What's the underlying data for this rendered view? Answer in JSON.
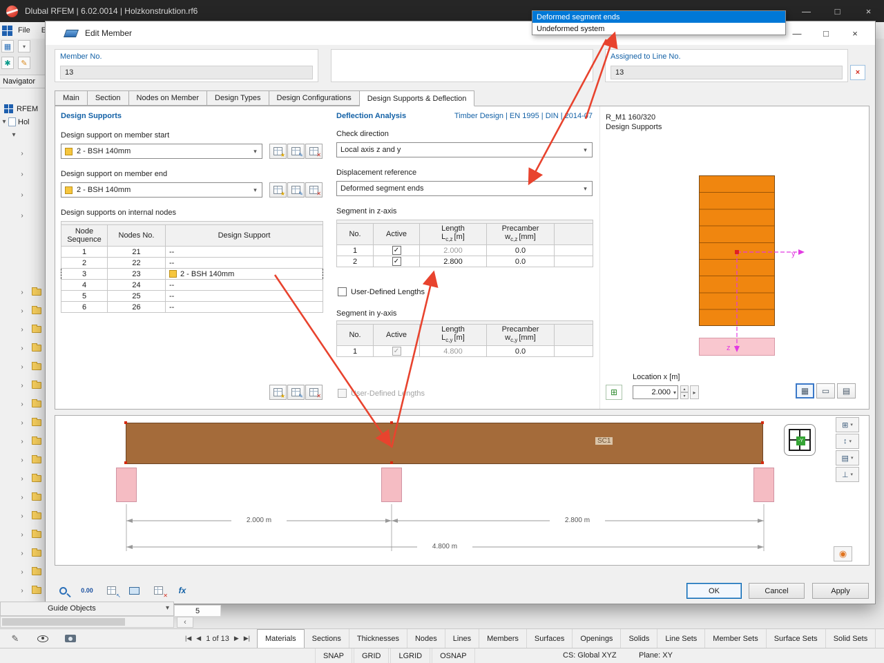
{
  "app": {
    "title": "Dlubal RFEM | 6.02.0014 | Holzkonstruktion.rf6",
    "menu_file": "File",
    "menu_edit_partial": "E"
  },
  "icons": {
    "minimize": "—",
    "maximize": "□",
    "close": "×",
    "chevron_down": "▾",
    "chevron_right": "›",
    "check": "✓",
    "nav_first": "|◀",
    "nav_prev": "◀",
    "nav_next": "▶",
    "nav_last": "▶|",
    "scroll_left": "‹",
    "spin_up": "▴",
    "spin_down": "▾",
    "arrow_right": "▸",
    "layers": "⊞",
    "updown": "↕",
    "list": "▤",
    "axes": "⊥",
    "ruler": "▭",
    "section": "▦",
    "eye": "◉",
    "pick_cross": "×",
    "pencil": "✎"
  },
  "overlay_dropdown": {
    "items": [
      {
        "label": "Deformed segment ends",
        "selected": true
      },
      {
        "label": "Undeformed system",
        "selected": false
      }
    ]
  },
  "navigator": {
    "title": "Navigator",
    "tab": "RFEM",
    "root": "Hol",
    "guide_objects": "Guide Objects"
  },
  "dialog": {
    "title": "Edit Member",
    "member_no": {
      "label": "Member No.",
      "value": "13"
    },
    "assigned_line": {
      "label": "Assigned to Line No.",
      "value": "13"
    },
    "tabs": [
      "Main",
      "Section",
      "Nodes on Member",
      "Design Types",
      "Design Configurations",
      "Design Supports & Deflection"
    ],
    "active_tab": "Design Supports & Deflection",
    "design_supports": {
      "title": "Design Supports",
      "start_label": "Design support on member start",
      "start_value": "2 - BSH 140mm",
      "end_label": "Design support on member end",
      "end_value": "2 - BSH 140mm",
      "internal_label": "Design supports on internal nodes",
      "table": {
        "headers": [
          "Node Sequence",
          "Nodes No.",
          "Design Support"
        ],
        "rows": [
          {
            "seq": "1",
            "node": "21",
            "support": "--"
          },
          {
            "seq": "2",
            "node": "22",
            "support": "--"
          },
          {
            "seq": "3",
            "node": "23",
            "support": "2 - BSH 140mm",
            "selected": true
          },
          {
            "seq": "4",
            "node": "24",
            "support": "--"
          },
          {
            "seq": "5",
            "node": "25",
            "support": "--"
          },
          {
            "seq": "6",
            "node": "26",
            "support": "--"
          }
        ]
      }
    },
    "deflection": {
      "title": "Deflection Analysis",
      "standard": "Timber Design | EN 1995 | DIN | 2014-07",
      "check_direction_label": "Check direction",
      "check_direction_value": "Local axis z and y",
      "displacement_label": "Displacement reference",
      "displacement_value": "Deformed segment ends",
      "segment_z": {
        "title": "Segment in z-axis",
        "headers": {
          "no": "No.",
          "active": "Active",
          "length_line1": "Length",
          "length_sym": "L",
          "length_sub": "c,z",
          "length_unit": "[m]",
          "precamber_line1": "Precamber",
          "precamber_sym": "w",
          "precamber_sub": "c,z",
          "precamber_unit": "[mm]"
        },
        "rows": [
          {
            "no": "1",
            "active": true,
            "length": "2.000",
            "precamber": "0.0"
          },
          {
            "no": "2",
            "active": true,
            "length": "2.800",
            "precamber": "0.0"
          }
        ],
        "user_defined_label": "User-Defined Lengths"
      },
      "segment_y": {
        "title": "Segment in y-axis",
        "headers": {
          "no": "No.",
          "active": "Active",
          "length_line1": "Length",
          "length_sym": "L",
          "length_sub": "c,y",
          "length_unit": "[m]",
          "precamber_line1": "Precamber",
          "precamber_sym": "w",
          "precamber_sub": "c,y",
          "precamber_unit": "[mm]"
        },
        "rows": [
          {
            "no": "1",
            "active": true,
            "length": "4.800",
            "precamber": "0.0"
          }
        ],
        "user_defined_label": "User-Defined Lengths"
      }
    },
    "preview": {
      "section_name": "R_M1 160/320",
      "subtitle": "Design Supports",
      "axis_y": "y",
      "axis_z": "z",
      "location_label": "Location x [m]",
      "location_value": "2.000",
      "view_cube_label": "-Y"
    },
    "beam_view": {
      "section_label": "SC1",
      "dim_left": "2.000 m",
      "dim_right": "2.800 m",
      "dim_total": "4.800 m"
    },
    "footer": {
      "decimals_icon_label": "0.00",
      "fx_icon_label": "fx"
    },
    "buttons": {
      "ok": "OK",
      "cancel": "Cancel",
      "apply": "Apply"
    }
  },
  "statusbar": {
    "row_value": "5",
    "pagination": "1 of 13",
    "tabs": [
      "Materials",
      "Sections",
      "Thicknesses",
      "Nodes",
      "Lines",
      "Members",
      "Surfaces",
      "Openings",
      "Solids",
      "Line Sets",
      "Member Sets",
      "Surface Sets",
      "Solid Sets"
    ],
    "active_tab": "Materials",
    "snap": [
      "SNAP",
      "GRID",
      "LGRID",
      "OSNAP"
    ],
    "cs": "CS: Global XYZ",
    "plane": "Plane: XY"
  },
  "colors": {
    "accent_blue": "#0078d7",
    "label_blue": "#1361a6",
    "section_orange": "#f0860f",
    "support_pink": "#f5bcc3",
    "beam_brown": "#a46b3a",
    "arrow_red": "#e8432e",
    "axis_magenta": "#e23ae2"
  }
}
